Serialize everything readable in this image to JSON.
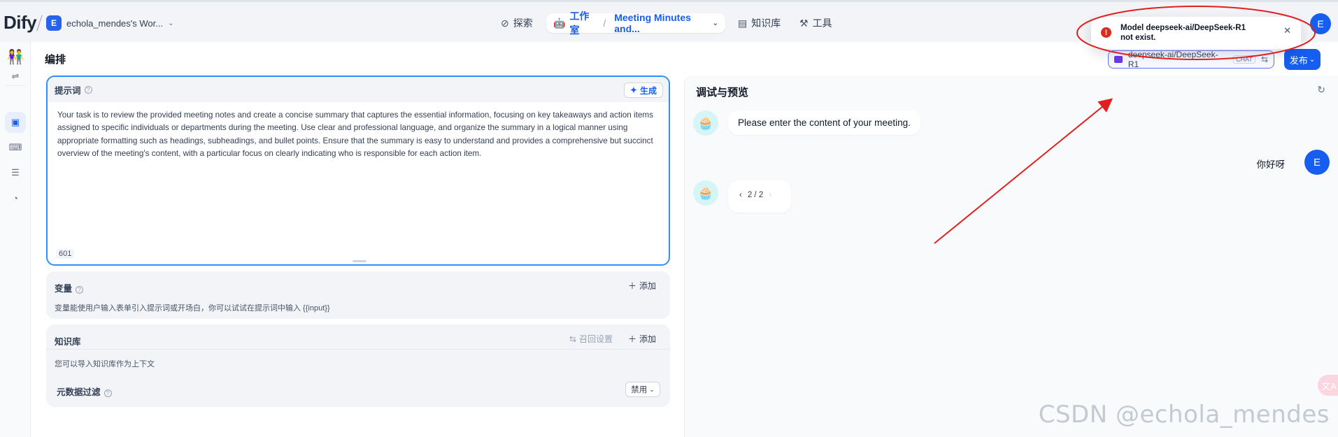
{
  "brand": {
    "logo_text": "Dify"
  },
  "workspace": {
    "avatar": "E",
    "name": "echola_mendes's Wor..."
  },
  "nav": {
    "explore": "探索",
    "studio": "工作室",
    "app_name": "Meeting Minutes and...",
    "knowledge": "知识库",
    "tools": "工具"
  },
  "user": {
    "initial": "E"
  },
  "editor": {
    "title": "编排",
    "model": {
      "name": "deepseek-ai/DeepSeek-R1",
      "mode": "CHAT"
    },
    "publish_label": "发布"
  },
  "prompt": {
    "label": "提示词",
    "generate_label": "生成",
    "text": "Your task is to review the provided meeting notes and create a concise summary that captures the essential information, focusing on key takeaways and action items assigned to specific individuals or departments during the meeting. Use clear and professional language, and organize the summary in a logical manner using appropriate formatting such as headings, subheadings, and bullet points. Ensure that the summary is easy to understand and provides a comprehensive but succinct overview of the meeting's content, with a particular focus on clearly indicating who is responsible for each action item.",
    "char_count": "601"
  },
  "variables": {
    "label": "变量",
    "add_label": "添加",
    "description": "变量能使用户输入表单引入提示词或开场白，你可以试试在提示词中输入 {{input}}"
  },
  "knowledge": {
    "label": "知识库",
    "recall_label": "召回设置",
    "add_label": "添加",
    "description": "您可以导入知识库作为上下文",
    "metadata_filter_label": "元数据过滤",
    "metadata_filter_value": "禁用"
  },
  "debug": {
    "title": "调试与预览",
    "opening_message": "Please enter the content of your meeting.",
    "user_message": "你好呀",
    "pager": "2 / 2"
  },
  "toast": {
    "type": "error",
    "message": "Model deepseek-ai/DeepSeek-R1 not exist."
  },
  "watermark": "CSDN @echola_mendes",
  "colors": {
    "accent": "#155eef",
    "error": "#d92d20",
    "annotation": "#e02020"
  }
}
